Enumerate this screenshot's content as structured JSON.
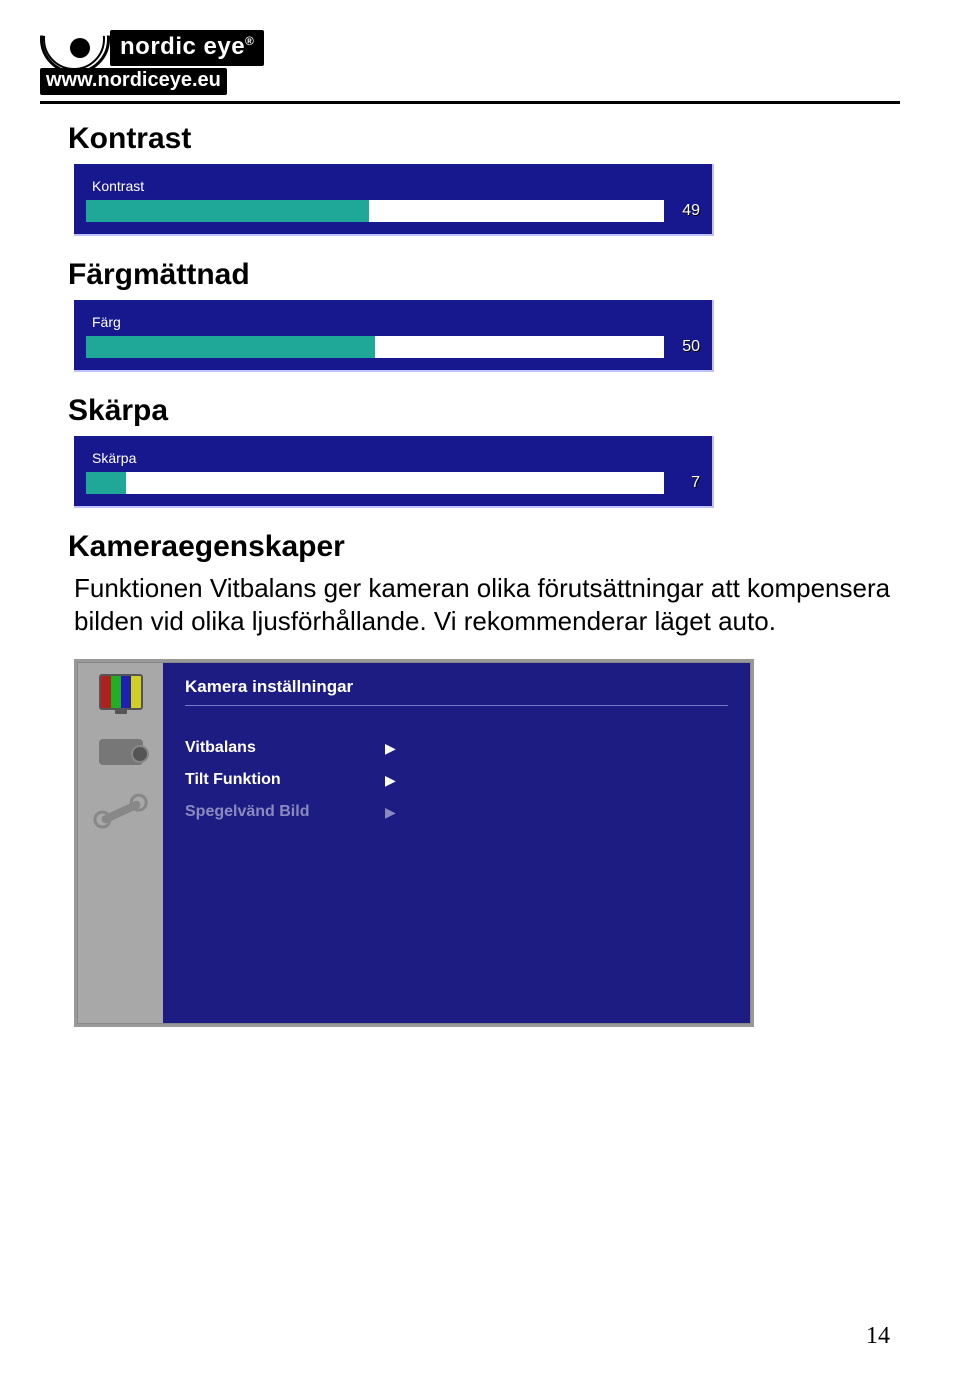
{
  "logo": {
    "brand": "nordic eye",
    "reg": "®",
    "url": "www.nordiceye.eu"
  },
  "sections": {
    "kontrast": {
      "title": "Kontrast",
      "slider_label": "Kontrast",
      "value": "49",
      "fill_pct": "49%"
    },
    "fargmattnad": {
      "title": "Färgmättnad",
      "slider_label": "Färg",
      "value": "50",
      "fill_pct": "50%"
    },
    "skarpa": {
      "title": "Skärpa",
      "slider_label": "Skärpa",
      "value": "7",
      "fill_pct": "7%"
    },
    "kameraegenskaper": {
      "title": "Kameraegenskaper",
      "body": "Funktionen Vitbalans ger kameran olika förutsättningar att kompensera bilden vid olika ljusförhållande. Vi rekommenderar läget auto."
    }
  },
  "camera_panel": {
    "title": "Kamera inställningar",
    "rows": [
      {
        "label": "Vitbalans",
        "dim": false
      },
      {
        "label": "Tilt Funktion",
        "dim": false
      },
      {
        "label": "Spegelvänd Bild",
        "dim": true
      }
    ]
  },
  "page_number": "14"
}
